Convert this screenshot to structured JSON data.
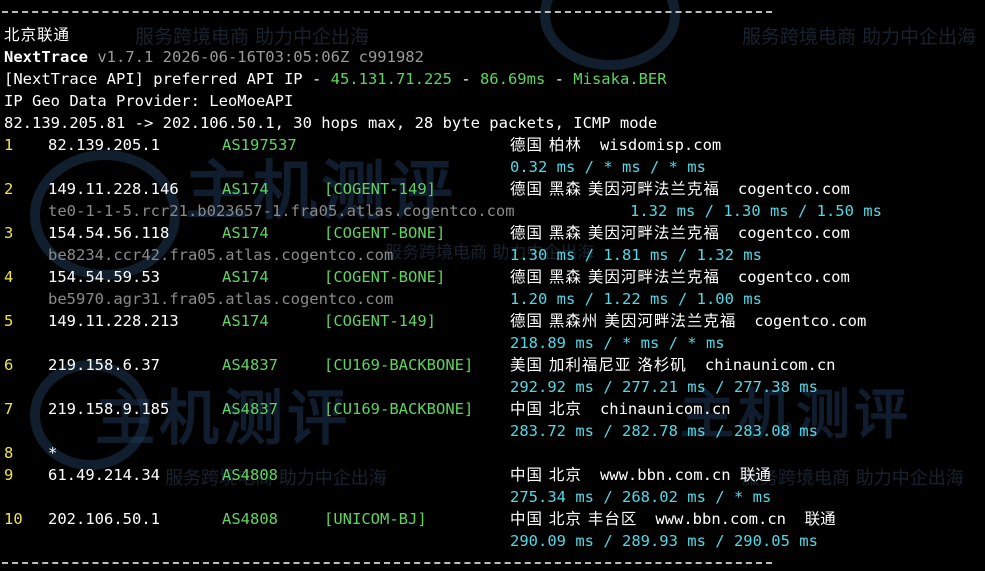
{
  "header": {
    "isp_title": "北京联通",
    "program_name": "NextTrace",
    "program_info": " v1.7.1 2026-06-16T03:05:06Z c991982",
    "api_prefix": "[NextTrace API] preferred API IP - ",
    "api_ip": "45.131.71.225",
    "api_sep1": " - ",
    "api_latency": "86.69ms",
    "api_sep2": " - ",
    "api_node": "Misaka.BER",
    "geo_provider": "IP Geo Data Provider: LeoMoeAPI",
    "trace_summary": "82.139.205.81 -> 202.106.50.1, 30 hops max, 28 byte packets, ICMP mode"
  },
  "watermark": {
    "slogan": "服务跨境电商 助力中企出海",
    "brand": "主机测评"
  },
  "hops": [
    {
      "num": "1",
      "ip": "82.139.205.1",
      "asn": "AS197537",
      "tag": "",
      "geo": "德国 柏林",
      "domain": "wisdomisp.com",
      "rdns": "",
      "times": "0.32 ms / * ms / * ms"
    },
    {
      "num": "2",
      "ip": "149.11.228.146",
      "asn": "AS174",
      "tag": "[COGENT-149]",
      "geo": "德国 黑森 美因河畔法兰克福",
      "domain": "cogentco.com",
      "rdns": "te0-1-1-5.rcr21.b023657-1.fra05.atlas.cogentco.com",
      "times": "1.32 ms / 1.30 ms / 1.50 ms"
    },
    {
      "num": "3",
      "ip": "154.54.56.118",
      "asn": "AS174",
      "tag": "[COGENT-BONE]",
      "geo": "德国 黑森 美因河畔法兰克福",
      "domain": "cogentco.com",
      "rdns": "be8234.ccr42.fra05.atlas.cogentco.com",
      "times": "1.30 ms / 1.81 ms / 1.32 ms"
    },
    {
      "num": "4",
      "ip": "154.54.59.53",
      "asn": "AS174",
      "tag": "[COGENT-BONE]",
      "geo": "德国 黑森 美因河畔法兰克福",
      "domain": "cogentco.com",
      "rdns": "be5970.agr31.fra05.atlas.cogentco.com",
      "times": "1.20 ms / 1.22 ms / 1.00 ms"
    },
    {
      "num": "5",
      "ip": "149.11.228.213",
      "asn": "AS174",
      "tag": "[COGENT-149]",
      "geo": "德国 黑森州 美因河畔法兰克福",
      "domain": "cogentco.com",
      "rdns": "",
      "times": "218.89 ms / * ms / * ms"
    },
    {
      "num": "6",
      "ip": "219.158.6.37",
      "asn": "AS4837",
      "tag": "[CU169-BACKBONE]",
      "geo": "美国 加利福尼亚 洛杉矶",
      "domain": "chinaunicom.cn",
      "rdns": "",
      "times": "292.92 ms / 277.21 ms / 277.38 ms"
    },
    {
      "num": "7",
      "ip": "219.158.9.185",
      "asn": "AS4837",
      "tag": "[CU169-BACKBONE]",
      "geo": "中国 北京",
      "domain": "chinaunicom.cn",
      "rdns": "",
      "times": "283.72 ms / 282.78 ms / 283.08 ms"
    },
    {
      "num": "8",
      "ip": "*",
      "asn": "",
      "tag": "",
      "geo": "",
      "domain": "",
      "rdns": "",
      "times": ""
    },
    {
      "num": "9",
      "ip": "61.49.214.34",
      "asn": "AS4808",
      "tag": "",
      "geo": "中国 北京",
      "domain": "www.bbn.com.cn 联通",
      "rdns": "",
      "times": "275.34 ms / 268.02 ms / * ms"
    },
    {
      "num": "10",
      "ip": "202.106.50.1",
      "asn": "AS4808",
      "tag": "[UNICOM-BJ]",
      "geo": "中国 北京 丰台区",
      "domain": "www.bbn.com.cn  联通",
      "rdns": "",
      "times": "290.09 ms / 289.93 ms / 290.05 ms"
    }
  ]
}
